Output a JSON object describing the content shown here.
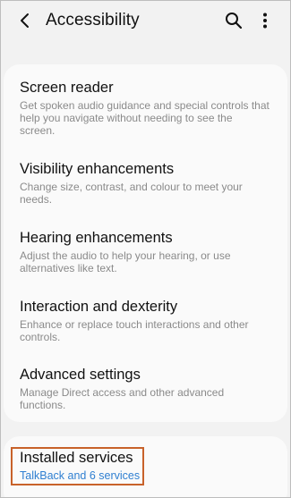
{
  "header": {
    "title": "Accessibility",
    "icons": {
      "back": "back-arrow-icon",
      "search": "search-icon",
      "more": "more-vertical-icon"
    }
  },
  "menu": {
    "items": [
      {
        "title": "Screen reader",
        "description": "Get spoken audio guidance and special controls that help you navigate without needing to see the screen."
      },
      {
        "title": "Visibility enhancements",
        "description": "Change size, contrast, and colour to meet your needs."
      },
      {
        "title": "Hearing enhancements",
        "description": "Adjust the audio to help your hearing, or use alternatives like text."
      },
      {
        "title": "Interaction and dexterity",
        "description": "Enhance or replace touch interactions and other controls."
      },
      {
        "title": "Advanced settings",
        "description": "Manage Direct access and other advanced functions."
      }
    ]
  },
  "installed_services": {
    "title": "Installed services",
    "subtitle": "TalkBack and 6 services"
  },
  "colors": {
    "background": "#f2f2f2",
    "card": "#fafafa",
    "accent": "#2f7fd1",
    "highlight": "#c8622a"
  }
}
